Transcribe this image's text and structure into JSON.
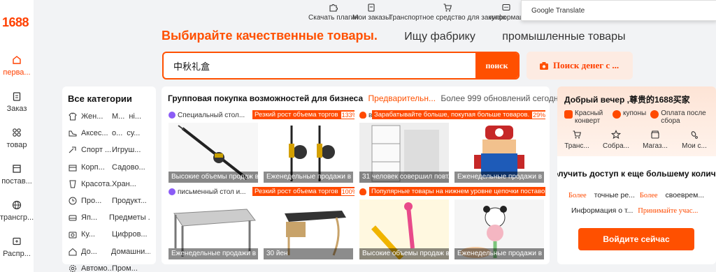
{
  "brand": {
    "logo": "1688",
    "accent": "#ff5000"
  },
  "rail": [
    {
      "label": "перва...",
      "icon": "home-icon",
      "active": true
    },
    {
      "label": "Заказ",
      "icon": "clipboard-icon"
    },
    {
      "label": "товар",
      "icon": "grid-icon"
    },
    {
      "label": "постав...",
      "icon": "store-icon"
    },
    {
      "label": "трансгр...",
      "icon": "globe-icon"
    },
    {
      "label": "Распр...",
      "icon": "share-icon"
    }
  ],
  "toolbar": [
    {
      "label": "Скачать плагин",
      "icon": "puzzle-icon"
    },
    {
      "label": "Мои заказы",
      "icon": "clipboard-icon"
    },
    {
      "label": "Транспортное средство для закупок",
      "icon": "cart-icon"
    },
    {
      "label": "информац",
      "icon": "message-icon"
    }
  ],
  "google_translate": {
    "label": "Google Translate"
  },
  "tabs": {
    "main": "Выбирайте качественные товары.",
    "factory": "Ищу фабрику",
    "industrial": "промышленные товары"
  },
  "search": {
    "value": "中秋礼盒",
    "button": "поиск",
    "photo_button": "Поиск денег с ..."
  },
  "categories": {
    "title": "Все категории",
    "items": [
      {
        "icon": "shirt-icon",
        "a": "Жен...",
        "b": "М...",
        "c": "ні..."
      },
      {
        "icon": "shoe-icon",
        "a": "Аксес...",
        "b": "о...",
        "c": "су..."
      },
      {
        "icon": "sport-icon",
        "a": "Спорт ...",
        "b": "Игруш...",
        "c": ""
      },
      {
        "icon": "box-icon",
        "a": "Корп...",
        "b": "Садово...",
        "c": ""
      },
      {
        "icon": "cup-icon",
        "a": "Красота...",
        "b": "Хран...",
        "c": ""
      },
      {
        "icon": "clock-icon",
        "a": "Про...",
        "b": "Продукт...",
        "c": ""
      },
      {
        "icon": "sofa-icon",
        "a": "Яп...",
        "b": "Предметы ...",
        "c": ""
      },
      {
        "icon": "camera-icon",
        "a": "Ку...",
        "b": "Цифров...",
        "c": ""
      },
      {
        "icon": "house-icon",
        "a": "До...",
        "b": "Домашни...",
        "c": ""
      },
      {
        "icon": "gear-icon",
        "a": "Автомо...",
        "b": "Пром...",
        "c": ""
      }
    ]
  },
  "group": {
    "title": "Групповая покупка возможностей для бизнеса",
    "preview": "Предварительн...",
    "updates": "Более 999 обновлений сегодня",
    "sections": [
      {
        "label": "Специальный стол...",
        "badge": "Резкий рост объема торгов",
        "pct": "133%"
      },
      {
        "label": "в.",
        "badge": "Зарабатывайте больше, покупая больше товаров.",
        "pct": "29%"
      },
      {
        "label": "письменный стол и...",
        "badge": "Резкий рост объема торгов",
        "pct": "100%"
      },
      {
        "label": "",
        "badge": "Популярные товары на нижнем уровне цепочки поставок",
        "pct": ""
      }
    ],
    "cards": [
      {
        "caption": "Высокие объемы продаж в ...",
        "img": "fishing-rod"
      },
      {
        "caption": "Еженедельные продажи в с...",
        "img": "fishing-reels"
      },
      {
        "caption": "31 человек совершил повт...",
        "img": "shelf"
      },
      {
        "caption": "Еженедельные продажи в с...",
        "img": "mario-toy"
      },
      {
        "caption": "Еженедельные продажи в с...",
        "img": "metal-table"
      },
      {
        "caption": "30 йен",
        "img": "desk"
      },
      {
        "caption": "Высокие объемы продаж в ...",
        "img": "pen-toys"
      },
      {
        "caption": "Еженедельные продажи в с...",
        "img": "panda-pen"
      }
    ]
  },
  "user": {
    "greeting": "Добрый вечер ,尊贵的1688买家",
    "perks": [
      "Красный конверт",
      "купоны",
      "Оплата после сбора"
    ],
    "quick": [
      "Транс...",
      "Собра...",
      "Магаз...",
      "Мои с..."
    ],
    "access": "олучить доступ к еще большему колич",
    "row1": {
      "a": "Более",
      "b": "точные ре...",
      "c": "Более",
      "d": "своеврем..."
    },
    "row2": {
      "a": "Информация о т...",
      "b": "Принимайте учас..."
    },
    "login": "Войдите сейчас"
  }
}
